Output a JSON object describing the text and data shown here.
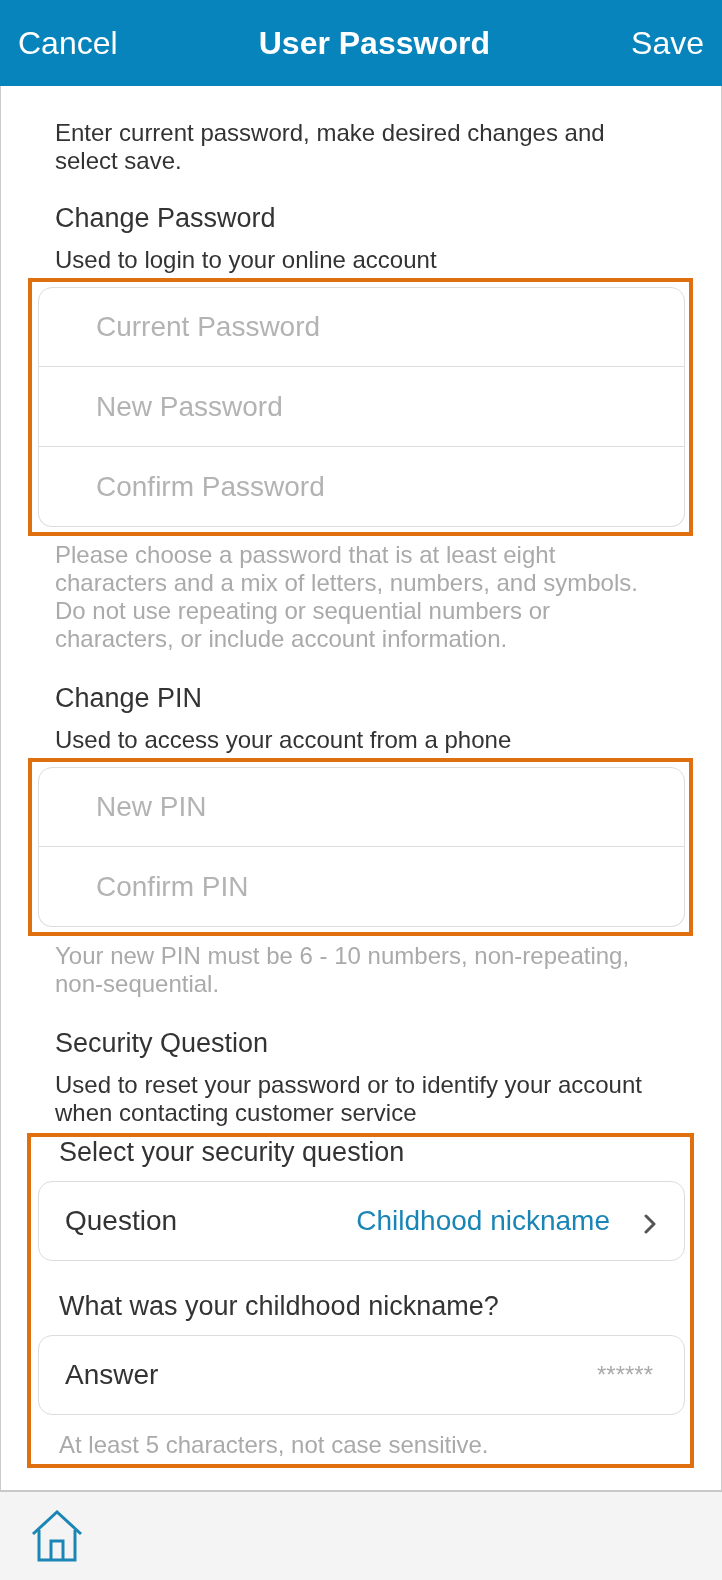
{
  "header": {
    "cancel": "Cancel",
    "title": "User Password",
    "save": "Save"
  },
  "intro": "Enter current password, make desired changes and select save.",
  "sections": [
    {
      "kind": "fields",
      "heading": "Change Password",
      "subtitle": "Used to login to your online account",
      "highlighted": true,
      "fields": [
        {
          "placeholder": "Current Password"
        },
        {
          "placeholder": "New Password"
        },
        {
          "placeholder": "Confirm Password"
        }
      ],
      "hint": "Please choose a password that is at least eight characters and a mix of letters, numbers, and symbols. Do not use repeating or sequential numbers or characters, or include account information."
    },
    {
      "kind": "fields",
      "heading": "Change PIN",
      "subtitle": "Used to access your account from a phone",
      "highlighted": true,
      "fields": [
        {
          "placeholder": "New PIN"
        },
        {
          "placeholder": "Confirm PIN"
        }
      ],
      "hint": "Your new PIN must be 6 - 10 numbers, non-repeating, non-sequential."
    },
    {
      "kind": "security",
      "heading": "Security Question",
      "subtitle": "Used to reset your password or to identify your account when contacting customer service",
      "highlighted": true,
      "select_label": "Select your security question",
      "question": {
        "label": "Question",
        "value": "Childhood nickname"
      },
      "prompt": "What was your childhood nickname?",
      "answer": {
        "label": "Answer",
        "value": "******"
      },
      "hint": "At least 5 characters, not case sensitive."
    }
  ]
}
